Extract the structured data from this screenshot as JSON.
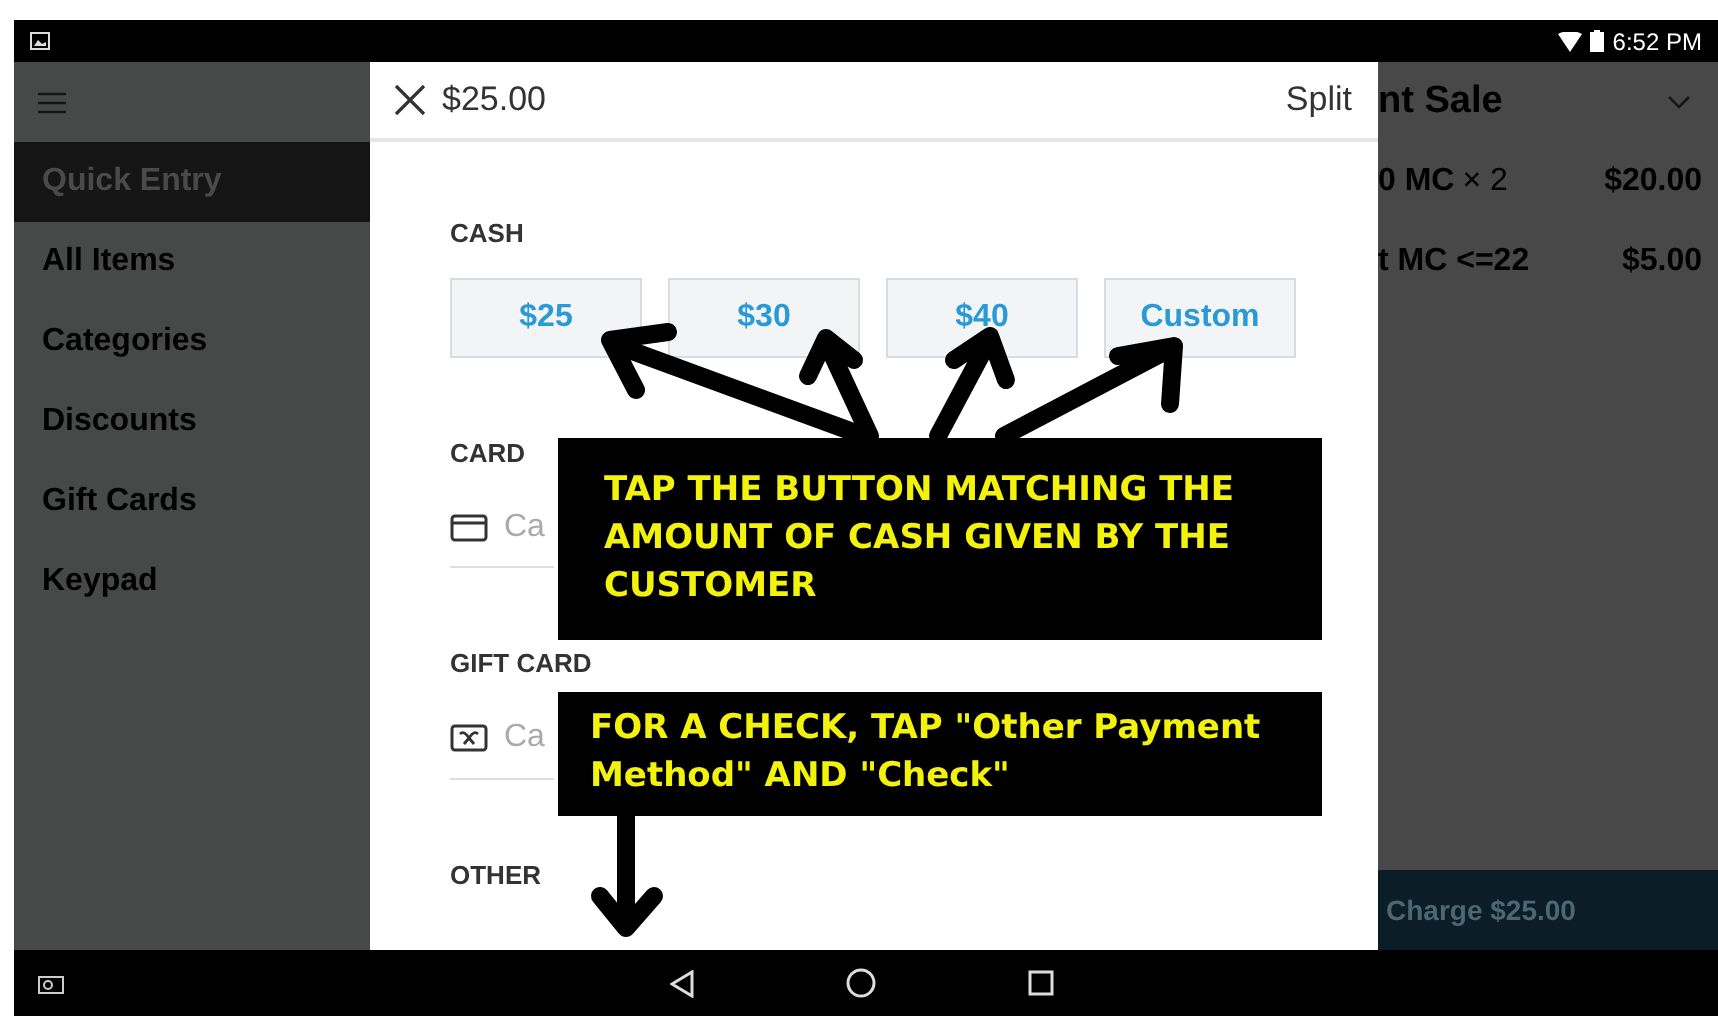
{
  "status_bar": {
    "time": "6:52 PM"
  },
  "sidebar": {
    "items": [
      {
        "label": "Quick Entry",
        "selected": true
      },
      {
        "label": "All Items",
        "selected": false
      },
      {
        "label": "Categories",
        "selected": false
      },
      {
        "label": "Discounts",
        "selected": false
      },
      {
        "label": "Gift Cards",
        "selected": false
      },
      {
        "label": "Keypad",
        "selected": false
      }
    ]
  },
  "modal": {
    "title": "$25.00",
    "split": "Split",
    "sections": [
      {
        "kind": "buttons",
        "label": "CASH",
        "buttons": [
          "$25",
          "$30",
          "$40",
          "Custom"
        ]
      },
      {
        "kind": "card_field",
        "label": "CARD",
        "placeholder": "Ca"
      },
      {
        "kind": "gift_card_field",
        "label": "GIFT CARD",
        "placeholder": "Ca"
      },
      {
        "kind": "heading",
        "label": "OTHER"
      }
    ]
  },
  "sale": {
    "title": "nt Sale",
    "rows": [
      {
        "name": "0 MC",
        "qty": "× 2",
        "price": "$20.00"
      },
      {
        "name": "t MC <=22",
        "price": "$5.00"
      }
    ],
    "charge": "Charge $25.00"
  },
  "annotations": [
    {
      "text": "TAP THE BUTTON MATCHING THE AMOUNT OF CASH GIVEN BY THE CUSTOMER"
    },
    {
      "text": "FOR A CHECK, TAP \"Other Payment Method\" AND \"Check\""
    }
  ]
}
